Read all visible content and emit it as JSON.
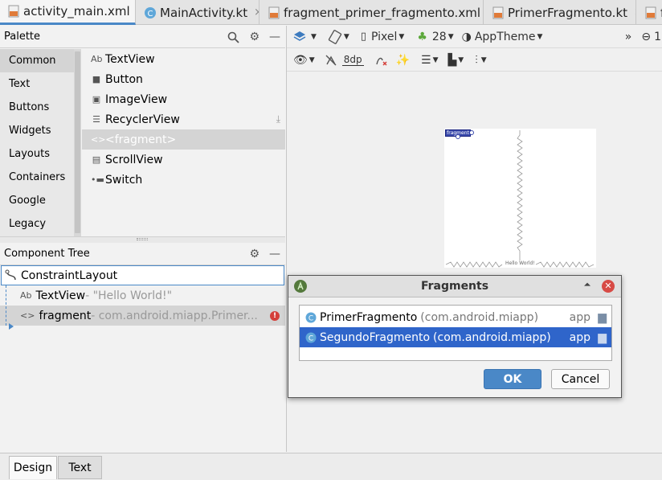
{
  "tabs": [
    {
      "label": "activity_main.xml",
      "close": "×"
    },
    {
      "label": "MainActivity.kt",
      "close": "×"
    },
    {
      "label": "fragment_primer_fragmento.xml",
      "close": "×"
    },
    {
      "label": "PrimerFragmento.kt",
      "close": "×"
    },
    {
      "label": "f"
    }
  ],
  "palette": {
    "title": "Palette",
    "categories": [
      "Common",
      "Text",
      "Buttons",
      "Widgets",
      "Layouts",
      "Containers",
      "Google",
      "Legacy"
    ],
    "widgets": [
      {
        "icon": "Ab",
        "label": "TextView"
      },
      {
        "icon": "■",
        "label": "Button"
      },
      {
        "icon": "▣",
        "label": "ImageView"
      },
      {
        "icon": "☰",
        "label": "RecyclerView"
      },
      {
        "icon": "<>",
        "label": "<fragment>"
      },
      {
        "icon": "▤",
        "label": "ScrollView"
      },
      {
        "icon": "•▬",
        "label": "Switch"
      }
    ]
  },
  "component_tree": {
    "title": "Component Tree",
    "root": "ConstraintLayout",
    "textview": {
      "label": "TextView",
      "detail": "- \"Hello World!\""
    },
    "fragment": {
      "label": "fragment",
      "detail": "- com.android.miapp.Primer..."
    }
  },
  "toolbar": {
    "margin": "8dp",
    "device": "Pixel",
    "api": "28",
    "theme": "AppTheme",
    "more": "»",
    "zoom_out": "⊖",
    "zoom_value": "1"
  },
  "preview": {
    "fragment_chip": "fragment",
    "hello": "Hello World!"
  },
  "dialog": {
    "title": "Fragments",
    "items": [
      {
        "name": "PrimerFragmento",
        "pkg": "(com.android.miapp)",
        "module": "app"
      },
      {
        "name": "SegundoFragmento",
        "pkg": "(com.android.miapp)",
        "module": "app"
      }
    ],
    "ok": "OK",
    "cancel": "Cancel"
  },
  "bottom_tabs": [
    "Design",
    "Text"
  ],
  "colors": {
    "accent": "#4a88c7",
    "selection": "#2f65ca",
    "ok_button": "#4a88c7"
  }
}
